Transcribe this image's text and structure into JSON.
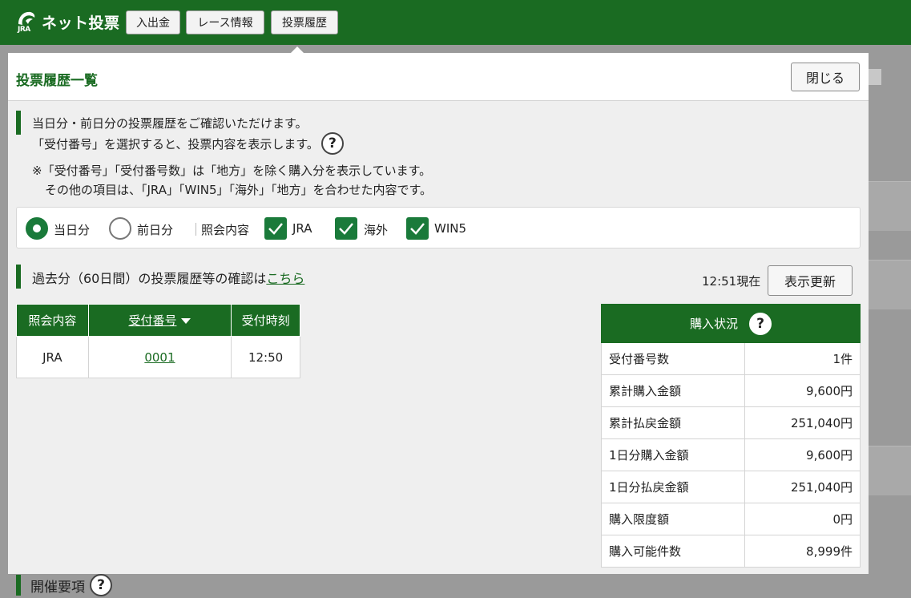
{
  "header": {
    "logo_small": "JRA",
    "logo_text": "ネット投票",
    "nav": [
      "入出金",
      "レース情報",
      "投票履歴"
    ]
  },
  "modal": {
    "title": "投票履歴一覧",
    "close_label": "閉じる",
    "intro_line1": "当日分・前日分の投票履歴をご確認いただけます。",
    "intro_line2": "「受付番号」を選択すると、投票内容を表示します。",
    "note_line1": "※「受付番号」「受付番号数」は「地方」を除く購入分を表示しています。",
    "note_line2": "その他の項目は、「JRA」「WIN5」「海外」「地方」を合わせた内容です。",
    "help_glyph": "?",
    "filter": {
      "radio_today": "当日分",
      "radio_yesterday": "前日分",
      "inquiry_label": "照会内容",
      "check_jra": "JRA",
      "check_overseas": "海外",
      "check_win5": "WIN5"
    },
    "past_text": "過去分（60日間）の投票履歴等の確認は",
    "past_link": "こちら",
    "as_of": "12:51現在",
    "refresh_label": "表示更新",
    "history_table": {
      "headers": [
        "照会内容",
        "受付番号",
        "受付時刻"
      ],
      "rows": [
        {
          "type": "JRA",
          "number": "0001",
          "time": "12:50"
        }
      ]
    },
    "status_table": {
      "title": "購入状況",
      "rows": [
        {
          "label": "受付番号数",
          "value": "1件"
        },
        {
          "label": "累計購入金額",
          "value": "9,600円"
        },
        {
          "label": "累計払戻金額",
          "value": "251,040円"
        },
        {
          "label": "1日分購入金額",
          "value": "9,600円"
        },
        {
          "label": "1日分払戻金額",
          "value": "251,040円"
        },
        {
          "label": "購入限度額",
          "value": "0円"
        },
        {
          "label": "購入可能件数",
          "value": "8,999件"
        }
      ]
    }
  },
  "background": {
    "section_title": "開催要項"
  },
  "colors": {
    "brand_green": "#1a6b22",
    "check_green": "#1a7a3a"
  }
}
